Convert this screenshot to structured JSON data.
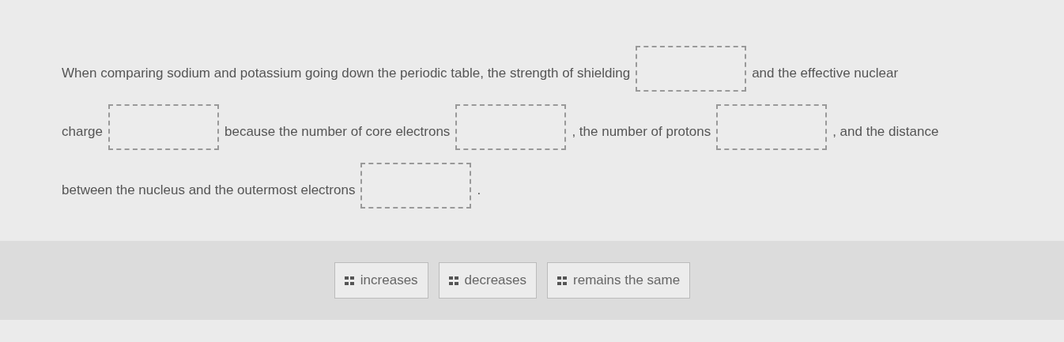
{
  "question": {
    "lines": [
      [
        {
          "kind": "text",
          "text": "When comparing sodium and potassium going down the periodic table, the strength of shielding"
        },
        {
          "kind": "blank"
        },
        {
          "kind": "text",
          "text": "and the effective nuclear"
        }
      ],
      [
        {
          "kind": "text",
          "text": "charge"
        },
        {
          "kind": "blank"
        },
        {
          "kind": "text",
          "text": "because the number of core electrons"
        },
        {
          "kind": "blank"
        },
        {
          "kind": "text",
          "text": ", the number of protons"
        },
        {
          "kind": "blank"
        },
        {
          "kind": "text",
          "text": ", and the distance"
        }
      ],
      [
        {
          "kind": "text",
          "text": "between the nucleus and the outermost electrons"
        },
        {
          "kind": "blank"
        },
        {
          "kind": "text",
          "text": "."
        }
      ]
    ]
  },
  "choices": [
    {
      "label": "increases"
    },
    {
      "label": "decreases"
    },
    {
      "label": "remains the same"
    }
  ]
}
